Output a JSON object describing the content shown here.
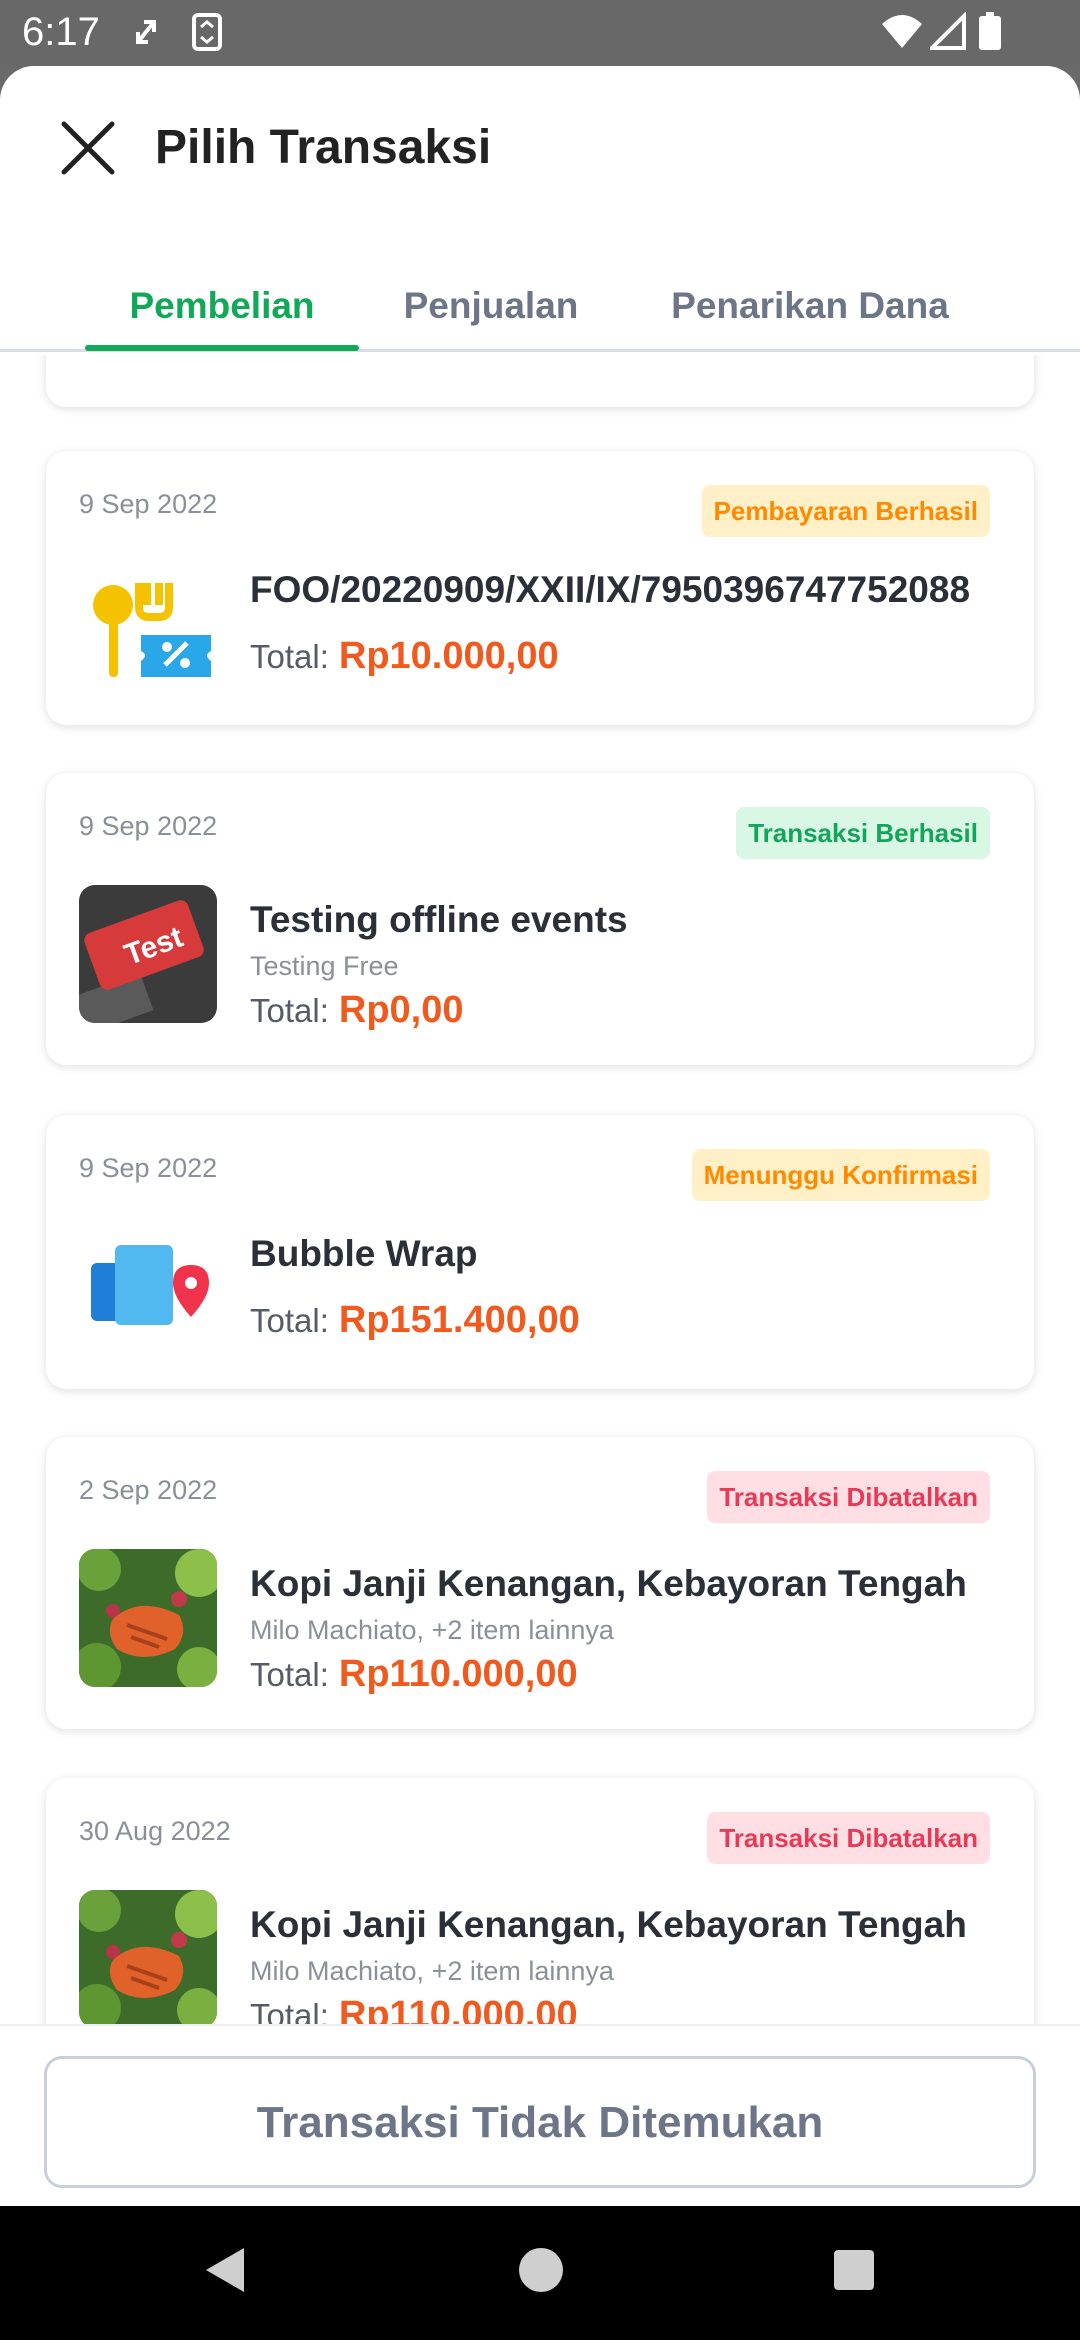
{
  "status_bar": {
    "time": "6:17"
  },
  "header": {
    "title": "Pilih Transaksi"
  },
  "tabs": [
    {
      "label": "Pembelian",
      "active": true
    },
    {
      "label": "Penjualan",
      "active": false
    },
    {
      "label": "Penarikan Dana",
      "active": false
    }
  ],
  "transactions": [
    {
      "date": "9 Sep 2022",
      "status": "Pembayaran Berhasil",
      "status_color": "#ff8a00",
      "title": "FOO/20220909/XXII/IX/7950396747752088",
      "subtitle": "",
      "total_label": "Total:",
      "amount": "Rp10.000,00",
      "icon": "food-voucher-icon"
    },
    {
      "date": "9 Sep 2022",
      "status": "Transaksi Berhasil",
      "status_color": "#13a65a",
      "title": "Testing offline events",
      "subtitle": "Testing Free",
      "total_label": "Total:",
      "amount": "Rp0,00",
      "icon": "test-keyboard-image"
    },
    {
      "date": "9 Sep 2022",
      "status": "Menunggu Konfirmasi",
      "status_color": "#ff8a00",
      "title": "Bubble Wrap",
      "subtitle": "",
      "total_label": "Total:",
      "amount": "Rp151.400,00",
      "icon": "delivery-location-icon"
    },
    {
      "date": "2 Sep 2022",
      "status": "Transaksi Dibatalkan",
      "status_color": "#e83a56",
      "title": "Kopi Janji Kenangan, Kebayoran Tengah",
      "subtitle": "Milo Machiato, +2 item lainnya",
      "total_label": "Total:",
      "amount": "Rp110.000,00",
      "icon": "salmon-salad-image"
    },
    {
      "date": "30 Aug 2022",
      "status": "Transaksi Dibatalkan",
      "status_color": "#e83a56",
      "title": "Kopi Janji Kenangan, Kebayoran Tengah",
      "subtitle": "Milo Machiato, +2 item lainnya",
      "total_label": "Total:",
      "amount": "Rp110.000,00",
      "icon": "salmon-salad-image"
    }
  ],
  "bottom": {
    "not_found_label": "Transaksi Tidak Ditemukan"
  },
  "colors": {
    "accent": "#11a857",
    "price": "#f05a1e"
  }
}
